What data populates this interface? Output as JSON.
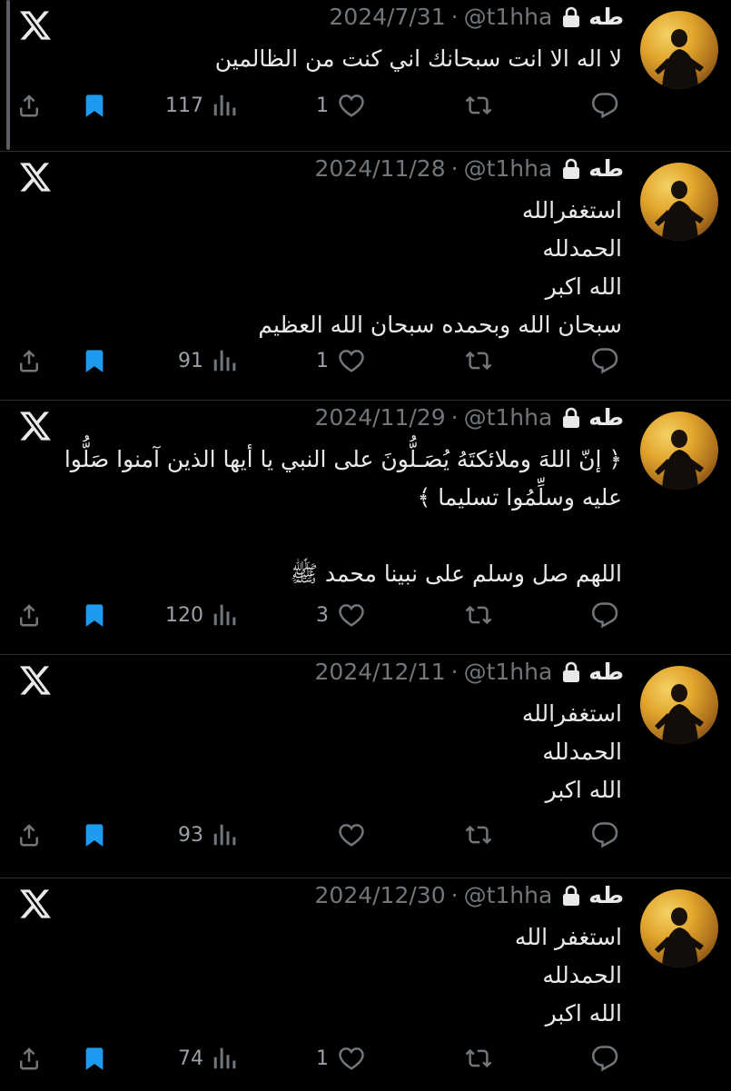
{
  "tweets": [
    {
      "name": "طه",
      "handle": "@t1hha",
      "date": "2024/7/31",
      "lines": [
        "لا اله الا انت سبحانك اني كنت من الظالمين"
      ],
      "views": "117",
      "likes": "1"
    },
    {
      "name": "طه",
      "handle": "@t1hha",
      "date": "2024/11/28",
      "lines": [
        "استغفرالله",
        "الحمدلله",
        "الله اكبر",
        "سبحان الله وبحمده سبحان الله العظيم"
      ],
      "views": "91",
      "likes": "1"
    },
    {
      "name": "طه",
      "handle": "@t1hha",
      "date": "2024/11/29",
      "lines": [
        "﴿ إنّ اللهَ وملائكتَهُ يُصَـلُّونَ على النبي يا أيها الذين آمنوا صَلُّوا",
        "عليه وسلِّمُوا تسليما ﴾",
        "",
        "اللهم صل وسلم على نبينا محمد ﷺ"
      ],
      "views": "120",
      "likes": "3"
    },
    {
      "name": "طه",
      "handle": "@t1hha",
      "date": "2024/12/11",
      "lines": [
        "استغفرالله",
        "الحمدلله",
        "الله اكبر"
      ],
      "views": "93",
      "likes": ""
    },
    {
      "name": "طه",
      "handle": "@t1hha",
      "date": "2024/12/30",
      "lines": [
        "استغفر الله",
        "الحمدلله",
        "الله اكبر"
      ],
      "views": "74",
      "likes": "1"
    }
  ],
  "colors": {
    "background": "#000000",
    "text": "#e7e9ea",
    "muted": "#71767b",
    "bookmark": "#1d9bf0",
    "separator": "#2a2d31"
  },
  "icons": [
    "x-logo-icon",
    "lock-icon",
    "reply-icon",
    "retweet-icon",
    "like-icon",
    "views-icon",
    "bookmark-icon",
    "share-icon"
  ]
}
